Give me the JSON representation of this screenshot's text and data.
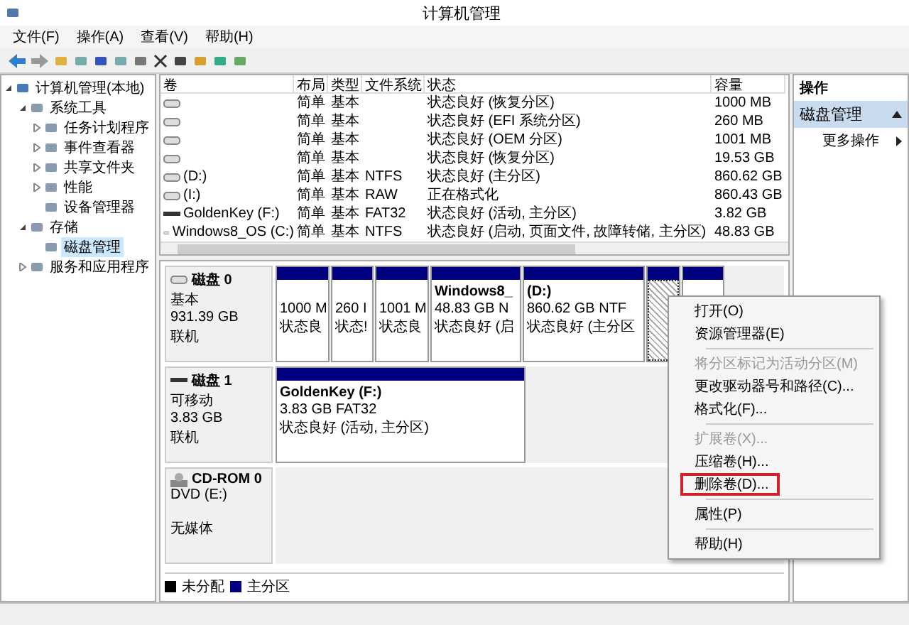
{
  "window": {
    "title": "计算机管理"
  },
  "menu": [
    "文件(F)",
    "操作(A)",
    "查看(V)",
    "帮助(H)"
  ],
  "tree": [
    {
      "label": "计算机管理(本地)",
      "expanded": true,
      "selected": false,
      "children": [
        {
          "label": "系统工具",
          "expanded": true,
          "selected": false,
          "children": [
            {
              "label": "任务计划程序",
              "expanded": false,
              "selected": false
            },
            {
              "label": "事件查看器",
              "expanded": false,
              "selected": false
            },
            {
              "label": "共享文件夹",
              "expanded": false,
              "selected": false
            },
            {
              "label": "性能",
              "expanded": false,
              "selected": false
            },
            {
              "label": "设备管理器",
              "selected": false
            }
          ]
        },
        {
          "label": "存储",
          "expanded": true,
          "selected": false,
          "children": [
            {
              "label": "磁盘管理",
              "selected": true
            }
          ]
        },
        {
          "label": "服务和应用程序",
          "expanded": false,
          "selected": false
        }
      ]
    }
  ],
  "table": {
    "columns": [
      "卷",
      "布局",
      "类型",
      "文件系统",
      "状态",
      "容量"
    ],
    "rows": [
      {
        "kind": "disk",
        "cells": [
          "",
          "简单",
          "基本",
          "",
          "状态良好 (恢复分区)",
          "1000 MB"
        ]
      },
      {
        "kind": "disk",
        "cells": [
          "",
          "简单",
          "基本",
          "",
          "状态良好 (EFI 系统分区)",
          "260 MB"
        ]
      },
      {
        "kind": "disk",
        "cells": [
          "",
          "简单",
          "基本",
          "",
          "状态良好 (OEM 分区)",
          "1001 MB"
        ]
      },
      {
        "kind": "disk",
        "cells": [
          "",
          "简单",
          "基本",
          "",
          "状态良好 (恢复分区)",
          "19.53 GB"
        ]
      },
      {
        "kind": "disk",
        "cells": [
          "(D:)",
          "简单",
          "基本",
          "NTFS",
          "状态良好 (主分区)",
          "860.62 GB"
        ]
      },
      {
        "kind": "disk",
        "cells": [
          "(I:)",
          "简单",
          "基本",
          "RAW",
          "正在格式化",
          "860.43 GB"
        ]
      },
      {
        "kind": "usb",
        "cells": [
          "GoldenKey (F:)",
          "简单",
          "基本",
          "FAT32",
          "状态良好 (活动, 主分区)",
          "3.82 GB"
        ]
      },
      {
        "kind": "disk",
        "cells": [
          "Windows8_OS (C:)",
          "简单",
          "基本",
          "NTFS",
          "状态良好 (启动, 页面文件, 故障转储, 主分区)",
          "48.83 GB"
        ]
      }
    ]
  },
  "disks": [
    {
      "kind": "disk",
      "name": "磁盘 0",
      "lines": [
        "基本",
        "931.39 GB",
        "联机"
      ],
      "partitions": [
        {
          "lines": [
            "1000 M",
            "状态良"
          ],
          "selected": false
        },
        {
          "lines": [
            "260 I",
            "状态!"
          ],
          "selected": false
        },
        {
          "lines": [
            "1001 M",
            "状态良"
          ],
          "selected": false
        },
        {
          "title": "Windows8_",
          "lines": [
            "48.83 GB N",
            "状态良好 (启"
          ],
          "selected": false
        },
        {
          "title": "(D:)",
          "lines": [
            "860.62 GB NTF",
            "状态良好 (主分区"
          ],
          "selected": false
        },
        {
          "selected": true
        },
        {
          "selected": false
        }
      ]
    },
    {
      "kind": "usb",
      "name": "磁盘 1",
      "lines": [
        "可移动",
        "3.83 GB",
        "联机"
      ],
      "partitions": [
        {
          "title": "GoldenKey  (F:)",
          "lines": [
            "3.83 GB FAT32",
            "状态良好 (活动, 主分区)"
          ],
          "selected": false
        }
      ]
    },
    {
      "kind": "cdrom",
      "name": "CD-ROM 0",
      "lines": [
        "DVD (E:)",
        "无媒体"
      ]
    }
  ],
  "legend": [
    {
      "label": "未分配",
      "color": "#000000"
    },
    {
      "label": "主分区",
      "color": "#000080"
    }
  ],
  "actions": {
    "title": "操作",
    "section": "磁盘管理",
    "items": [
      "更多操作"
    ]
  },
  "context_menu": [
    {
      "kind": "item",
      "label": "打开(O)",
      "disabled": false,
      "highlighted": false
    },
    {
      "kind": "item",
      "label": "资源管理器(E)",
      "disabled": false,
      "highlighted": false
    },
    {
      "kind": "separator"
    },
    {
      "kind": "item",
      "label": "将分区标记为活动分区(M)",
      "disabled": true,
      "highlighted": false
    },
    {
      "kind": "item",
      "label": "更改驱动器号和路径(C)...",
      "disabled": false,
      "highlighted": false
    },
    {
      "kind": "item",
      "label": "格式化(F)...",
      "disabled": false,
      "highlighted": false
    },
    {
      "kind": "separator"
    },
    {
      "kind": "item",
      "label": "扩展卷(X)...",
      "disabled": true,
      "highlighted": false
    },
    {
      "kind": "item",
      "label": "压缩卷(H)...",
      "disabled": false,
      "highlighted": false
    },
    {
      "kind": "item",
      "label": "删除卷(D)...",
      "disabled": false,
      "highlighted": true
    },
    {
      "kind": "separator"
    },
    {
      "kind": "item",
      "label": "属性(P)",
      "disabled": false,
      "highlighted": false
    },
    {
      "kind": "separator"
    },
    {
      "kind": "item",
      "label": "帮助(H)",
      "disabled": false,
      "highlighted": false
    }
  ]
}
